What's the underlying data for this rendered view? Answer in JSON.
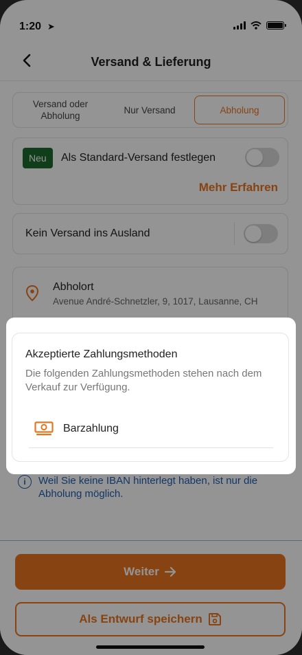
{
  "status": {
    "time": "1:20"
  },
  "header": {
    "title": "Versand & Lieferung"
  },
  "segments": [
    {
      "label": "Versand oder Abholung",
      "active": false
    },
    {
      "label": "Nur Versand",
      "active": false
    },
    {
      "label": "Abholung",
      "active": true
    }
  ],
  "standard": {
    "badge": "Neu",
    "label": "Als Standard-Versand festlegen",
    "enabled": false,
    "more": "Mehr Erfahren"
  },
  "abroad": {
    "label": "Kein Versand ins Ausland",
    "enabled": false
  },
  "pickup": {
    "title": "Abholort",
    "address": "Avenue André-Schnetzler, 9, 1017, Lausanne, CH"
  },
  "payment": {
    "title": "Akzeptierte Zahlungsmethoden",
    "description": "Die folgenden Zahlungsmethoden stehen nach dem Verkauf zur Verfügung.",
    "methods": [
      {
        "label": "Barzahlung",
        "icon": "cash-icon"
      }
    ]
  },
  "info": {
    "text": "Weil Sie keine IBAN hinterlegt haben, ist nur die Abholung möglich."
  },
  "actions": {
    "next": "Weiter",
    "save_draft": "Als Entwurf speichern"
  },
  "colors": {
    "accent": "#e8741e",
    "badge": "#1c6b2e",
    "info": "#1f5fb0"
  }
}
